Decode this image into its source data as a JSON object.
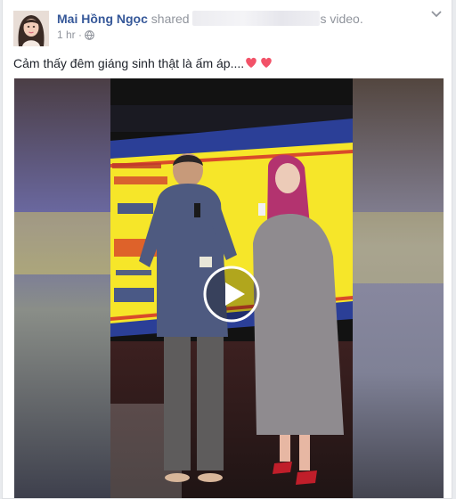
{
  "post": {
    "author": "Mai Hồng Ngọc",
    "action_prefix": "shared",
    "action_suffix": "s video.",
    "time": "1 hr",
    "separator": "·",
    "text": "Cảm thấy đêm giáng sinh thật là ấm áp...."
  },
  "icons": {
    "privacy": "globe-icon",
    "menu": "chevron-down-icon",
    "play": "play-icon",
    "emoji": "heart-icon"
  },
  "colors": {
    "author_link": "#365899",
    "meta_text": "#90949c",
    "body_text": "#1d2129",
    "heart": "#f25268",
    "banner_blue": "#2b3f97",
    "banner_yellow": "#f6e629"
  }
}
